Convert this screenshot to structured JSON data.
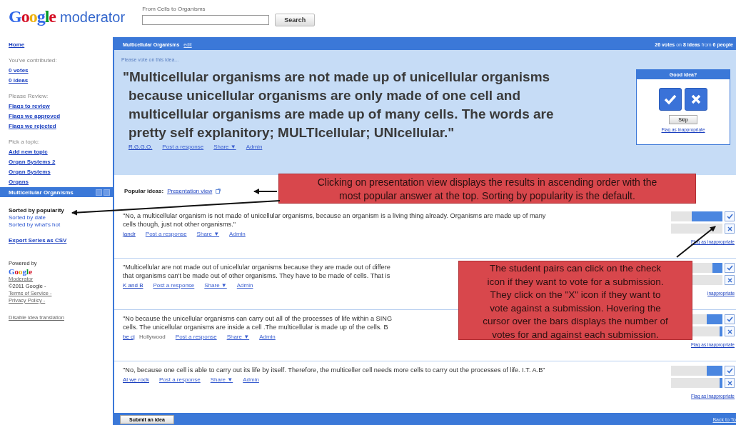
{
  "header": {
    "logo": "Google",
    "product": "moderator",
    "search_label": "From Cells to Organisms",
    "search_button": "Search"
  },
  "sidebar": {
    "home": "Home",
    "sections": [
      {
        "heading": "You've contributed:",
        "links": [
          "0 votes",
          "0 ideas"
        ]
      },
      {
        "heading": "Please Review:",
        "links": [
          "Flags to review",
          "Flags we approved",
          "Flags we rejected"
        ]
      }
    ],
    "topics_heading": "Pick a topic:",
    "topics": [
      {
        "label": "Add new topic",
        "selected": false
      },
      {
        "label": "Organ Systems 2",
        "selected": false
      },
      {
        "label": "Organ Systems",
        "selected": false
      },
      {
        "label": "Organs",
        "selected": false
      },
      {
        "label": "Multicellular Organisms",
        "selected": true
      }
    ],
    "sorts": [
      {
        "label": "Sorted by popularity",
        "selected": true
      },
      {
        "label": "Sorted by date",
        "selected": false
      },
      {
        "label": "Sorted by what's hot",
        "selected": false
      }
    ],
    "export": "Export Series as CSV",
    "powered_by": "Powered by",
    "powered_logo": "Google",
    "powered_product": "Moderator",
    "copyright": "©2011 Google -",
    "legal_links": [
      "Terms of Service -",
      "Privacy Policy -"
    ],
    "disable": "Disable idea translation"
  },
  "topbar": {
    "title": "Multicellular Organisms",
    "edit": "edit",
    "stats": "**26 votes** on **8 ideas** from **6 people**"
  },
  "vote": {
    "prompt": "Please vote on this idea...",
    "quote_lines": [
      "\"Multicellular organisms are not made up of unicellular organisms",
      "because unicellular organisms are only made of one cell and",
      "multicellular organisms are made up of many cells. The words are",
      "pretty self explanitory; MULTIcellular; UNIcellular.\""
    ],
    "author": "R.G.G.O.",
    "actions": [
      "Post a response",
      "Share ▼",
      "Admin"
    ],
    "box": {
      "title": "Good idea?",
      "skip": "Skip",
      "flag": "Flag as inappropriate"
    }
  },
  "popular_label": "Popular ideas:",
  "presentation_link": "Presentation view",
  "ideas": [
    {
      "lines": [
        "\"No, a multicellular organism is not made of unicellular organisms, because an organism is a living thing already. Organisms are made up of many",
        "cells though, just not other organisms.\""
      ],
      "author": "jandr",
      "actions": [
        "Post a response",
        "Share ▼",
        "Admin"
      ],
      "votes_for": {
        "level": 0.6
      },
      "flag": "Flag as inappropriate"
    },
    {
      "lines": [
        "\"Multicellular are not made out of unicellular organisms because they are made out of differe",
        "that organisms can't be made out of other organisms. They have to be made of cells. That is"
      ],
      "author": "K and B",
      "actions": [
        "Post a response",
        "Share ▼",
        "Admin"
      ],
      "votes_for": {
        "level": 0.2
      },
      "flag": "inappropriate"
    },
    {
      "lines": [
        "\"No because the unicellular organisms can carry out all of the processes of life within a SING",
        "cells. The unicellular organisms are inside a cell .The multicellular is made up of the cells. B"
      ],
      "author": "be cj",
      "location": "Hollywood",
      "actions": [
        "Post a response",
        "Share ▼",
        "Admin"
      ],
      "votes_for": {
        "level": 0.3
      },
      "votes_against": {
        "level": 0.05
      },
      "flag": "Flag as inappropriate"
    },
    {
      "lines": [
        "\"No, because one cell is able to carry out its life by itself. Therefore, the multiceller cell needs more cells to carry out the processes of life. I.T. A.B\""
      ],
      "author": "Al we rock",
      "actions": [
        "Post a response",
        "Share ▼",
        "Admin"
      ],
      "votes_for": {
        "level": 0.3
      },
      "votes_against": {
        "level": 0.05
      },
      "flag": "Flag as inappropriate"
    }
  ],
  "footer": {
    "submit": "Submit an idea",
    "back": "Back to To"
  },
  "callouts": [
    {
      "lines": [
        "Clicking on presentation view displays the results in ascending order with the",
        "most popular answer at the top.  Sorting by popularity is the default."
      ]
    },
    {
      "lines": [
        "The student pairs can click on the check",
        "icon if they want to vote for a submission.",
        "They click on the \"X\" icon if they want to",
        "vote against a submission.  Hovering the",
        "cursor over the bars displays the number of",
        "votes for and against each submission."
      ]
    }
  ]
}
